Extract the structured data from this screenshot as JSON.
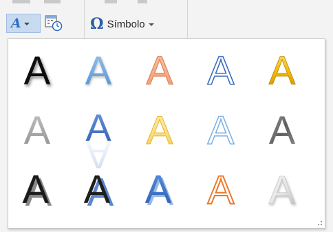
{
  "ribbon": {
    "wordart_button": {
      "glyph": "A",
      "icon": "wordart-icon"
    },
    "datetime_button": {
      "icon": "date-time-icon"
    },
    "symbol_button": {
      "icon": "omega-icon",
      "glyph": "Ω",
      "label": "Símbolo"
    }
  },
  "gallery": {
    "letter": "A",
    "resize_icon": "resize-grip-icon",
    "styles": [
      "fill-black-shadow",
      "fill-blue-accent-shadow",
      "fill-orange-outline-soft",
      "outline-blue-white",
      "fill-gold-gradient",
      "fill-gray-gradient",
      "fill-blue-reflection",
      "fill-yellow-soft",
      "outline-lightblue-white",
      "fill-dark-gray-gradient",
      "fill-black-bevel-shadow",
      "fill-black-blue-shadow",
      "fill-blue-bevel",
      "outline-orange-white",
      "fill-white-silver-bevel"
    ]
  },
  "colors": {
    "accent_blue": "#2f6fc4",
    "selected_button_bg": "#c8daf0"
  }
}
